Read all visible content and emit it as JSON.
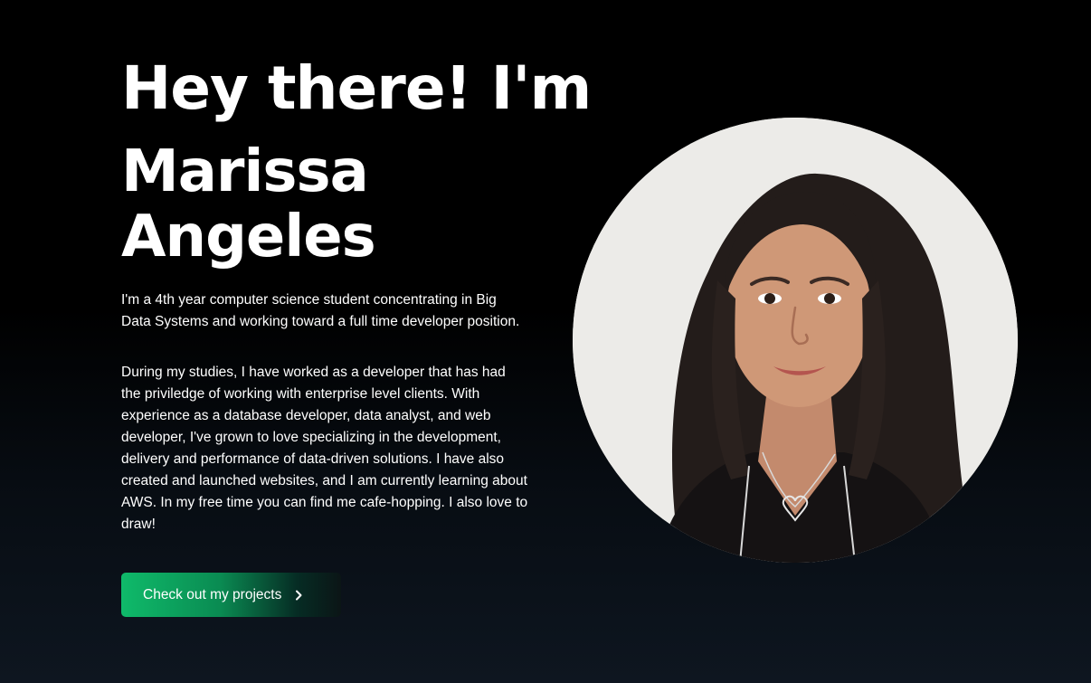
{
  "hero": {
    "heading_line1": "Hey there! I'm",
    "heading_name": "Marissa Angeles",
    "bio_1": "I'm a 4th year computer science student concentrating in Big Data Systems and working toward a full time developer position.",
    "bio_2": "During my studies, I have worked as a developer that has had the priviledge of working with enterprise level clients. With experience as a database developer, data analyst, and web developer, I've grown to love specializing in the development, delivery and performance of data-driven solutions. I have also created and launched websites, and I am currently learning about AWS. In my free time you can find me cafe-hopping. I also love to draw!",
    "cta_label": "Check out my projects",
    "cta_icon": "chevron-right-icon",
    "portrait_alt": "Portrait of Marissa Angeles"
  },
  "colors": {
    "background": "#000000",
    "accent_start": "#0fba6a",
    "accent_end": "#0b1516",
    "text": "#ffffff"
  }
}
